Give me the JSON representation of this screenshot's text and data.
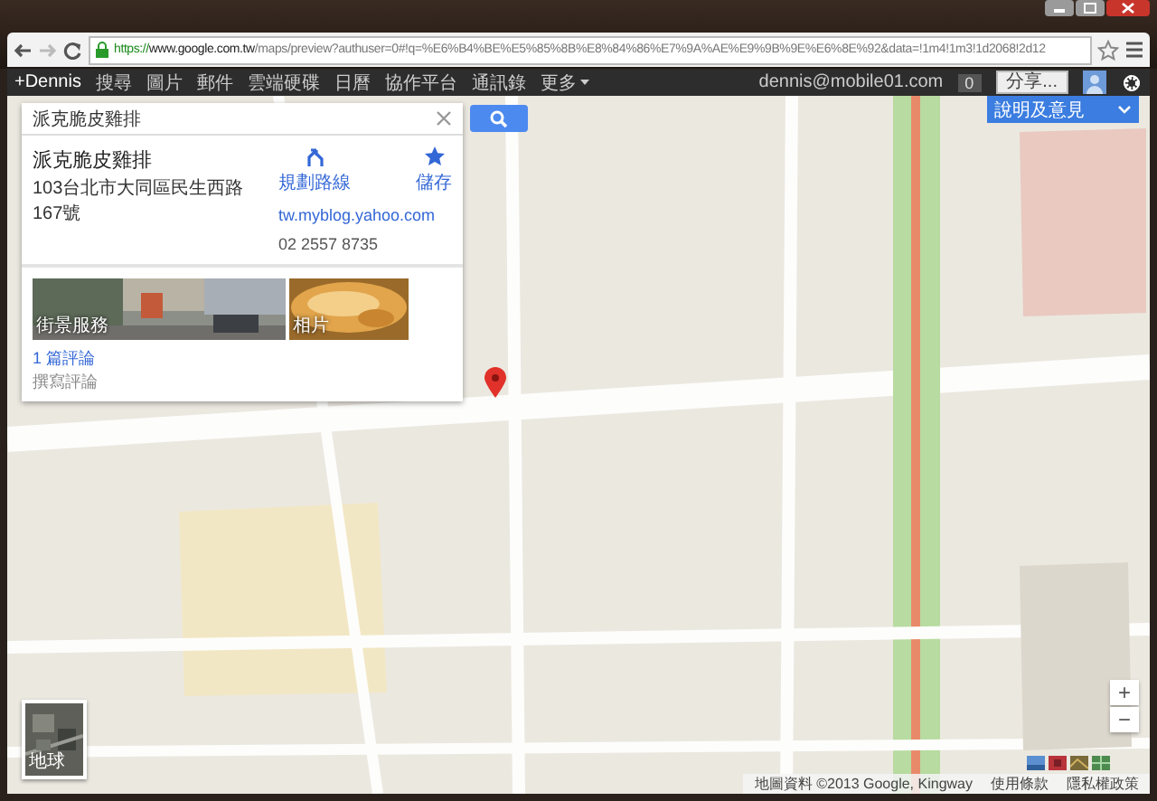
{
  "browser": {
    "url_scheme": "https://",
    "url_host": "www.google.com.tw",
    "url_path": "/maps/preview?authuser=0#!q=%E6%B4%BE%E5%85%8B%E8%84%86%E7%9A%AE%E9%9B%9E%E6%8E%92&data=!1m4!1m3!1d2068!2d12"
  },
  "google_bar": {
    "items": [
      {
        "label": "+Dennis"
      },
      {
        "label": "搜尋"
      },
      {
        "label": "圖片"
      },
      {
        "label": "郵件"
      },
      {
        "label": "雲端硬碟"
      },
      {
        "label": "日曆"
      },
      {
        "label": "協作平台"
      },
      {
        "label": "通訊錄"
      },
      {
        "label": "更多",
        "kind": "menu"
      }
    ],
    "account": "dennis@mobile01.com",
    "notifications": "0",
    "share": "分享..."
  },
  "search": {
    "value": "派克脆皮雞排"
  },
  "place": {
    "name": "派克脆皮雞排",
    "address": "103台北市大同區民生西路167號",
    "actions": [
      {
        "label": "規劃路線",
        "kind": "directions"
      },
      {
        "label": "儲存",
        "kind": "save"
      }
    ],
    "website": "tw.myblog.yahoo.com",
    "phone": "02 2557 8735",
    "photos": [
      {
        "label": "街景服務",
        "kind": "street"
      },
      {
        "label": "相片",
        "kind": "food"
      }
    ],
    "reviews": "1 篇評論",
    "write_review": "撰寫評論"
  },
  "feedback": "說明及意見",
  "earth": "地球",
  "zoom_in": "+",
  "zoom_out": "−",
  "footer": {
    "attribution": "地圖資料 ©2013 Google, Kingway",
    "links": [
      "使用條款",
      "隱私權政策"
    ]
  }
}
